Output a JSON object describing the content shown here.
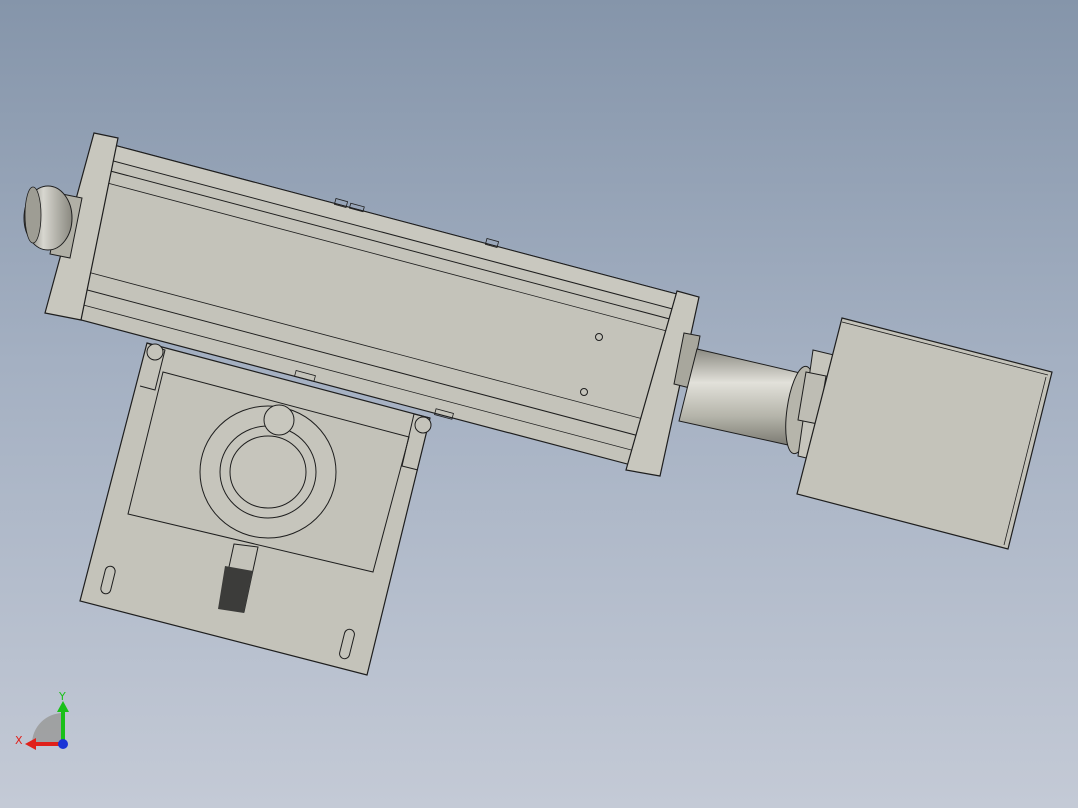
{
  "viewport": {
    "background_top": "#8595aa",
    "background_bottom": "#c4cad6"
  },
  "model": {
    "part_fill": "#c4c3ba",
    "part_edge": "#1e1e1e",
    "shaft_fill": "#b8b7ad",
    "shadow_fill": "#3c3c3a"
  },
  "triad": {
    "x_label": "X",
    "y_label": "Y",
    "x_color": "#e0201a",
    "y_color": "#19c019",
    "z_color": "#1a33d6",
    "x_icon": "x-axis-arrow-icon",
    "y_icon": "y-axis-arrow-icon",
    "z_icon": "z-axis-dot-icon"
  }
}
